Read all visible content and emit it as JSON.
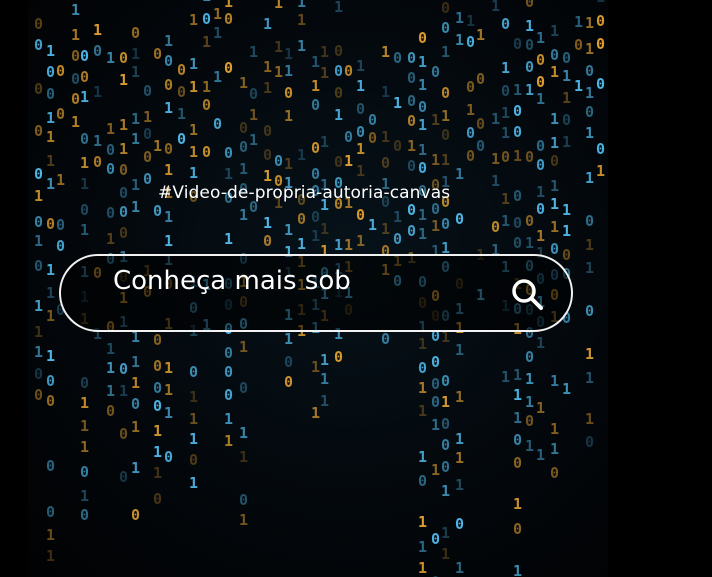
{
  "overlay": {
    "hashtag": "#Video-de-propria-autoria-canvas"
  },
  "search": {
    "value": "Conheça mais sob",
    "icon": "search-icon"
  },
  "colors": {
    "background": "#000000",
    "text": "#ffffff",
    "glyph_cyan": "#4fb8e8",
    "glyph_amber": "#e0a030"
  }
}
